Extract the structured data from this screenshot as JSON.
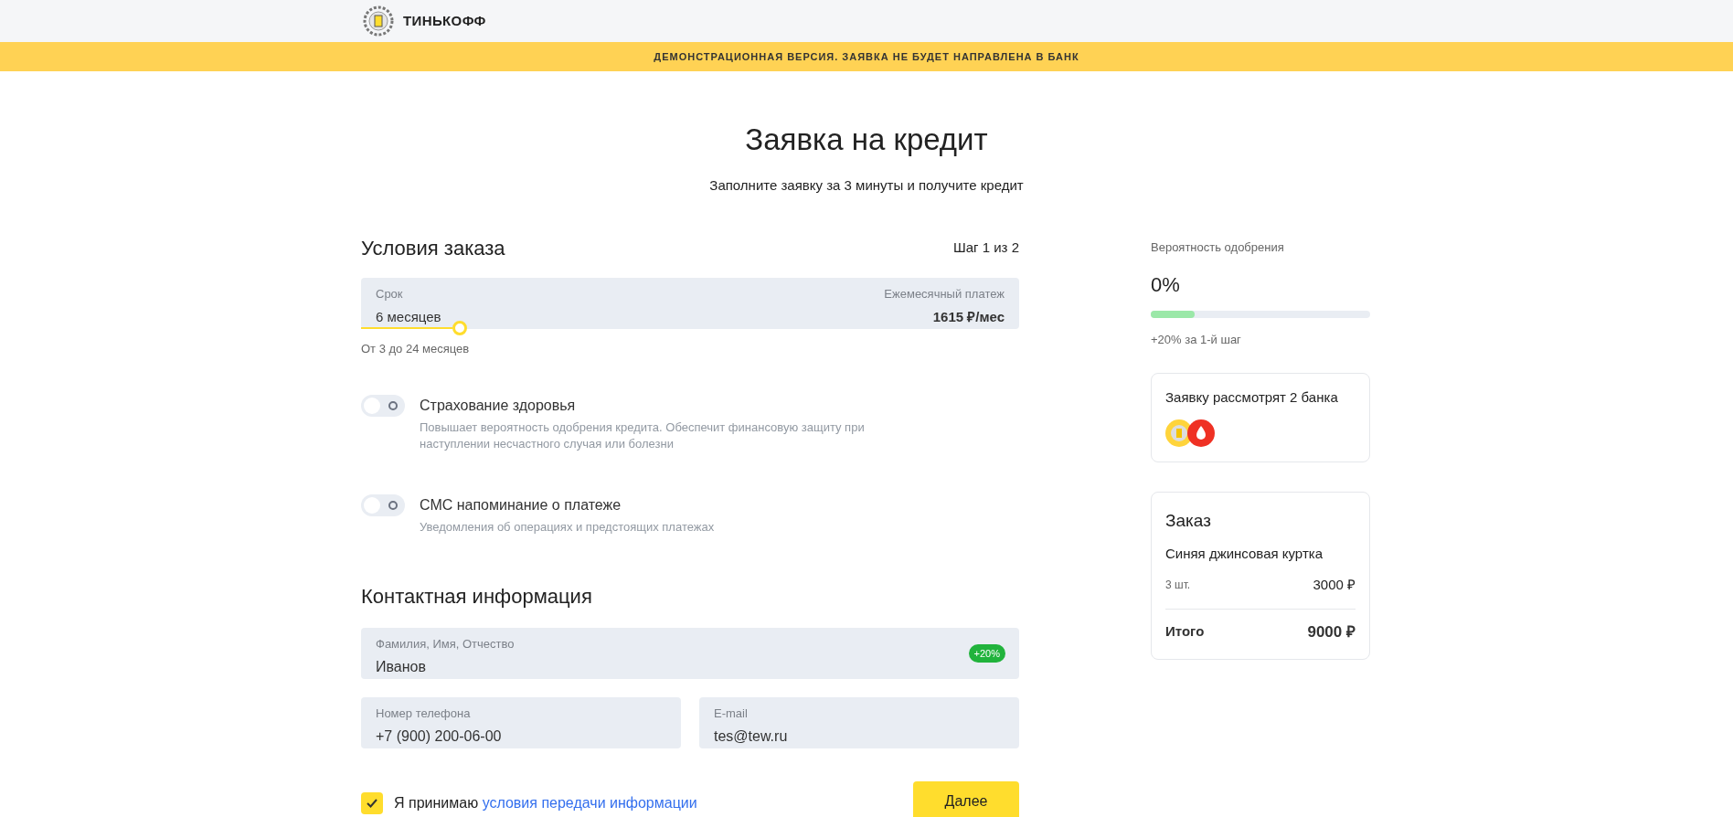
{
  "header": {
    "logo_text": "ТИНЬКОФФ"
  },
  "banner": "ДЕМОНСТРАЦИОННАЯ ВЕРСИЯ. ЗАЯВКА НЕ БУДЕТ НАПРАВЛЕНА В БАНК",
  "title": "Заявка на кредит",
  "subtitle": "Заполните заявку за 3 минуты и получите кредит",
  "order_terms": {
    "heading": "Условия заказа",
    "step": "Шаг 1 из 2",
    "term": {
      "label": "Срок",
      "value": "6 месяцев",
      "level": 0.15,
      "hint": "От 3 до 24 месяцев"
    },
    "payment": {
      "label": "Ежемесячный платеж",
      "value": "1615 ₽/мес"
    },
    "options": [
      {
        "title": "Страхование здоровья",
        "description": "Повышает вероятность одобрения кредита. Обеспечит финансовую защиту при наступлении несчастного случая или болезни",
        "on": false
      },
      {
        "title": "СМС напоминание о платеже",
        "description": "Уведомления об операциях и предстоящих платежах",
        "on": false
      }
    ]
  },
  "contact": {
    "heading": "Контактная информация",
    "fields": [
      {
        "label": "Фамилия, Имя, Отчество",
        "value": "Иванов",
        "badge": "+20%"
      },
      {
        "label": "Номер телефона",
        "value": "+7 (900) 200-06-00"
      },
      {
        "label": "E-mail",
        "value": "tes@tew.ru"
      }
    ]
  },
  "consent": {
    "checked": true,
    "text": "Я принимаю",
    "link": "условия передачи информации"
  },
  "next_button": "Далее",
  "approval": {
    "label": "Вероятность одобрения",
    "value": "0%",
    "level": 0.2,
    "note": "+20% за 1-й шаг"
  },
  "banks": {
    "title": "Заявку рассмотрят 2 банка"
  },
  "order": {
    "heading": "Заказ",
    "item": "Синяя джинсовая куртка",
    "quantity": "3 шт.",
    "price": "3000 ₽",
    "total_label": "Итого",
    "total": "9000 ₽"
  }
}
